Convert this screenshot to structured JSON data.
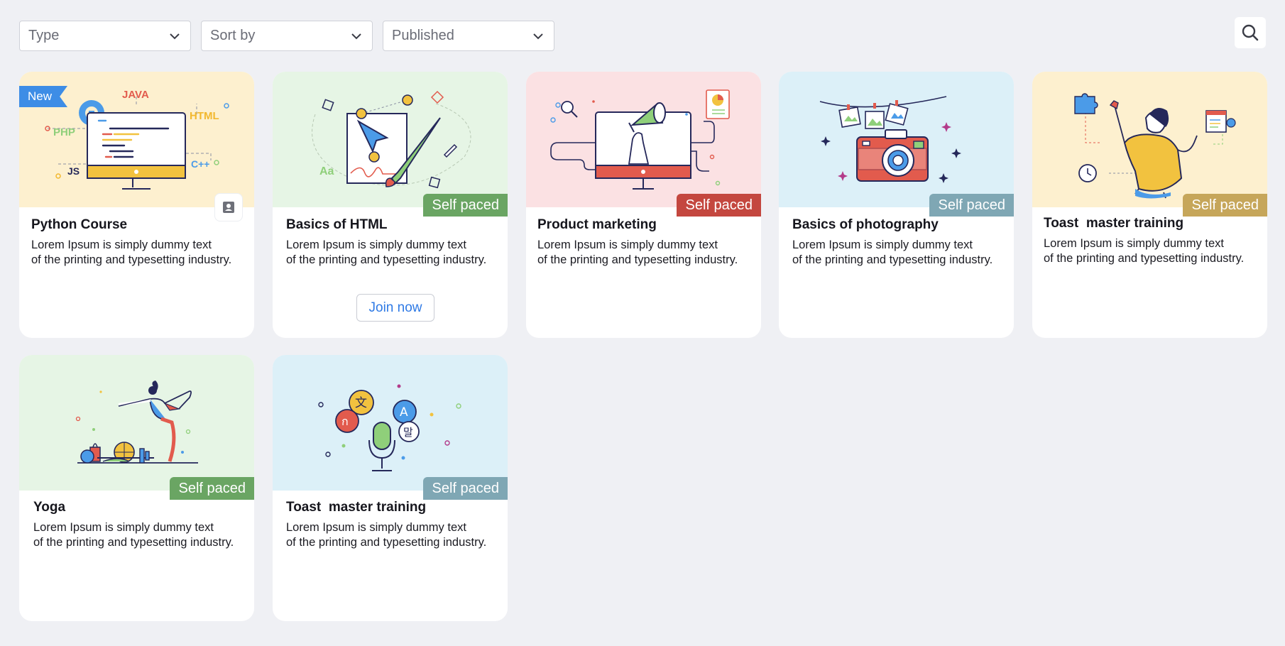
{
  "toolbar": {
    "filters": [
      {
        "label": "Type"
      },
      {
        "label": "Sort by"
      },
      {
        "label": "Published"
      }
    ]
  },
  "cards": [
    {
      "title": "Python Course",
      "desc_line1": "Lorem Ipsum is simply dummy text",
      "desc_line2": "of the printing and typesetting industry.",
      "new_tag": "New",
      "hero_labels": {
        "java": "JAVA",
        "html": "HTML",
        "php": "PHP",
        "js": "JS",
        "cpp": "C++"
      }
    },
    {
      "title": "Basics of HTML",
      "desc_line1": "Lorem Ipsum is simply dummy text",
      "desc_line2": "of the printing and typesetting industry.",
      "badge": "Self paced",
      "badge_color": "#6aa563",
      "button": "Join now",
      "hero_labels": {
        "aa": "Aa"
      }
    },
    {
      "title": "Product marketing",
      "desc_line1": "Lorem Ipsum is simply dummy text",
      "desc_line2": "of the printing and typesetting industry.",
      "badge": "Self paced",
      "badge_color": "#c4473f"
    },
    {
      "title": "Basics of photography",
      "desc_line1": "Lorem Ipsum is simply dummy text",
      "desc_line2": "of the printing and typesetting industry.",
      "badge": "Self paced",
      "badge_color": "#7fa7b4"
    },
    {
      "title": "Toast  master training",
      "desc_line1": "Lorem Ipsum is simply dummy text",
      "desc_line2": "of the printing and typesetting industry.",
      "badge": "Self paced",
      "badge_color": "#c6a65a"
    },
    {
      "title": "Yoga",
      "desc_line1": "Lorem Ipsum is simply dummy text",
      "desc_line2": "of the printing and typesetting industry.",
      "badge": "Self paced",
      "badge_color": "#6aa563"
    },
    {
      "title": "Toast  master training",
      "desc_line1": "Lorem Ipsum is simply dummy text",
      "desc_line2": "of the printing and typesetting industry.",
      "badge": "Self paced",
      "badge_color": "#7fa7b4"
    }
  ],
  "icons": {
    "chevron": "chevron-down-icon",
    "search": "search-icon",
    "contact": "contact-card-icon"
  },
  "colors": {
    "background": "#eff0f4",
    "new_tag": "#3d8de6",
    "link": "#2f7ae5",
    "hero_yellow": "#fdf0cf",
    "hero_green": "#e6f5e5",
    "hero_pink": "#fbe1e3",
    "hero_blue": "#dcf0f8"
  }
}
